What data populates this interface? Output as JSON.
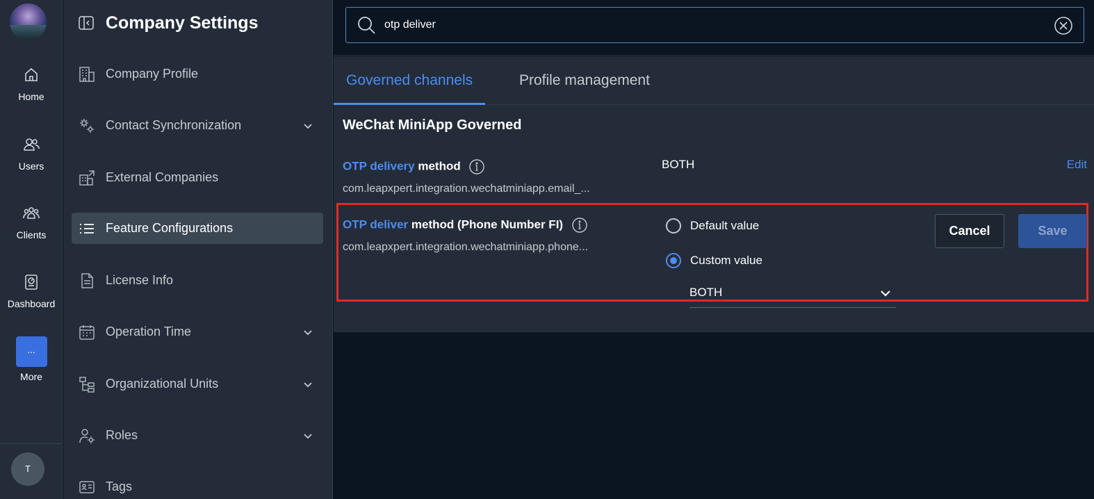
{
  "rail": {
    "items": [
      {
        "label": "Home",
        "icon": "home-icon"
      },
      {
        "label": "Users",
        "icon": "users-icon"
      },
      {
        "label": "Clients",
        "icon": "clients-icon"
      },
      {
        "label": "Dashboard",
        "icon": "dashboard-icon"
      },
      {
        "label": "More",
        "icon": "more-icon",
        "glyph": "..."
      }
    ],
    "user_initial": "T"
  },
  "sidebar": {
    "title": "Company Settings",
    "items": [
      {
        "label": "Company Profile",
        "icon": "building-icon",
        "expandable": false
      },
      {
        "label": "Contact Synchronization",
        "icon": "sync-gear-icon",
        "expandable": true
      },
      {
        "label": "External Companies",
        "icon": "external-building-icon",
        "expandable": false
      },
      {
        "label": "Feature Configurations",
        "icon": "list-icon",
        "expandable": false,
        "active": true
      },
      {
        "label": "License Info",
        "icon": "document-icon",
        "expandable": false
      },
      {
        "label": "Operation Time",
        "icon": "calendar-icon",
        "expandable": true
      },
      {
        "label": "Organizational Units",
        "icon": "org-tree-icon",
        "expandable": true
      },
      {
        "label": "Roles",
        "icon": "user-gear-icon",
        "expandable": true
      },
      {
        "label": "Tags",
        "icon": "tag-card-icon",
        "expandable": false
      }
    ]
  },
  "search": {
    "value": "otp deliver",
    "placeholder": ""
  },
  "tabs": [
    {
      "label": "Governed channels",
      "active": true
    },
    {
      "label": "Profile management",
      "active": false
    }
  ],
  "section": {
    "title": "WeChat MiniApp Governed"
  },
  "rows": [
    {
      "name_highlight": "OTP delivery",
      "name_rest": " method",
      "key": "com.leapxpert.integration.wechatminiapp.email_...",
      "value": "BOTH",
      "edit_label": "Edit"
    },
    {
      "name_highlight": "OTP deliver",
      "name_rest": " method (Phone Number FI)",
      "key": "com.leapxpert.integration.wechatminiapp.phone...",
      "options": [
        {
          "label": "Default value",
          "checked": false
        },
        {
          "label": "Custom value",
          "checked": true
        }
      ],
      "selected_value": "BOTH",
      "cancel_label": "Cancel",
      "save_label": "Save"
    }
  ],
  "colors": {
    "accent": "#4f8cf0",
    "highlight_border": "#e02a28",
    "background": "#0b1522",
    "panel": "#232c38"
  }
}
